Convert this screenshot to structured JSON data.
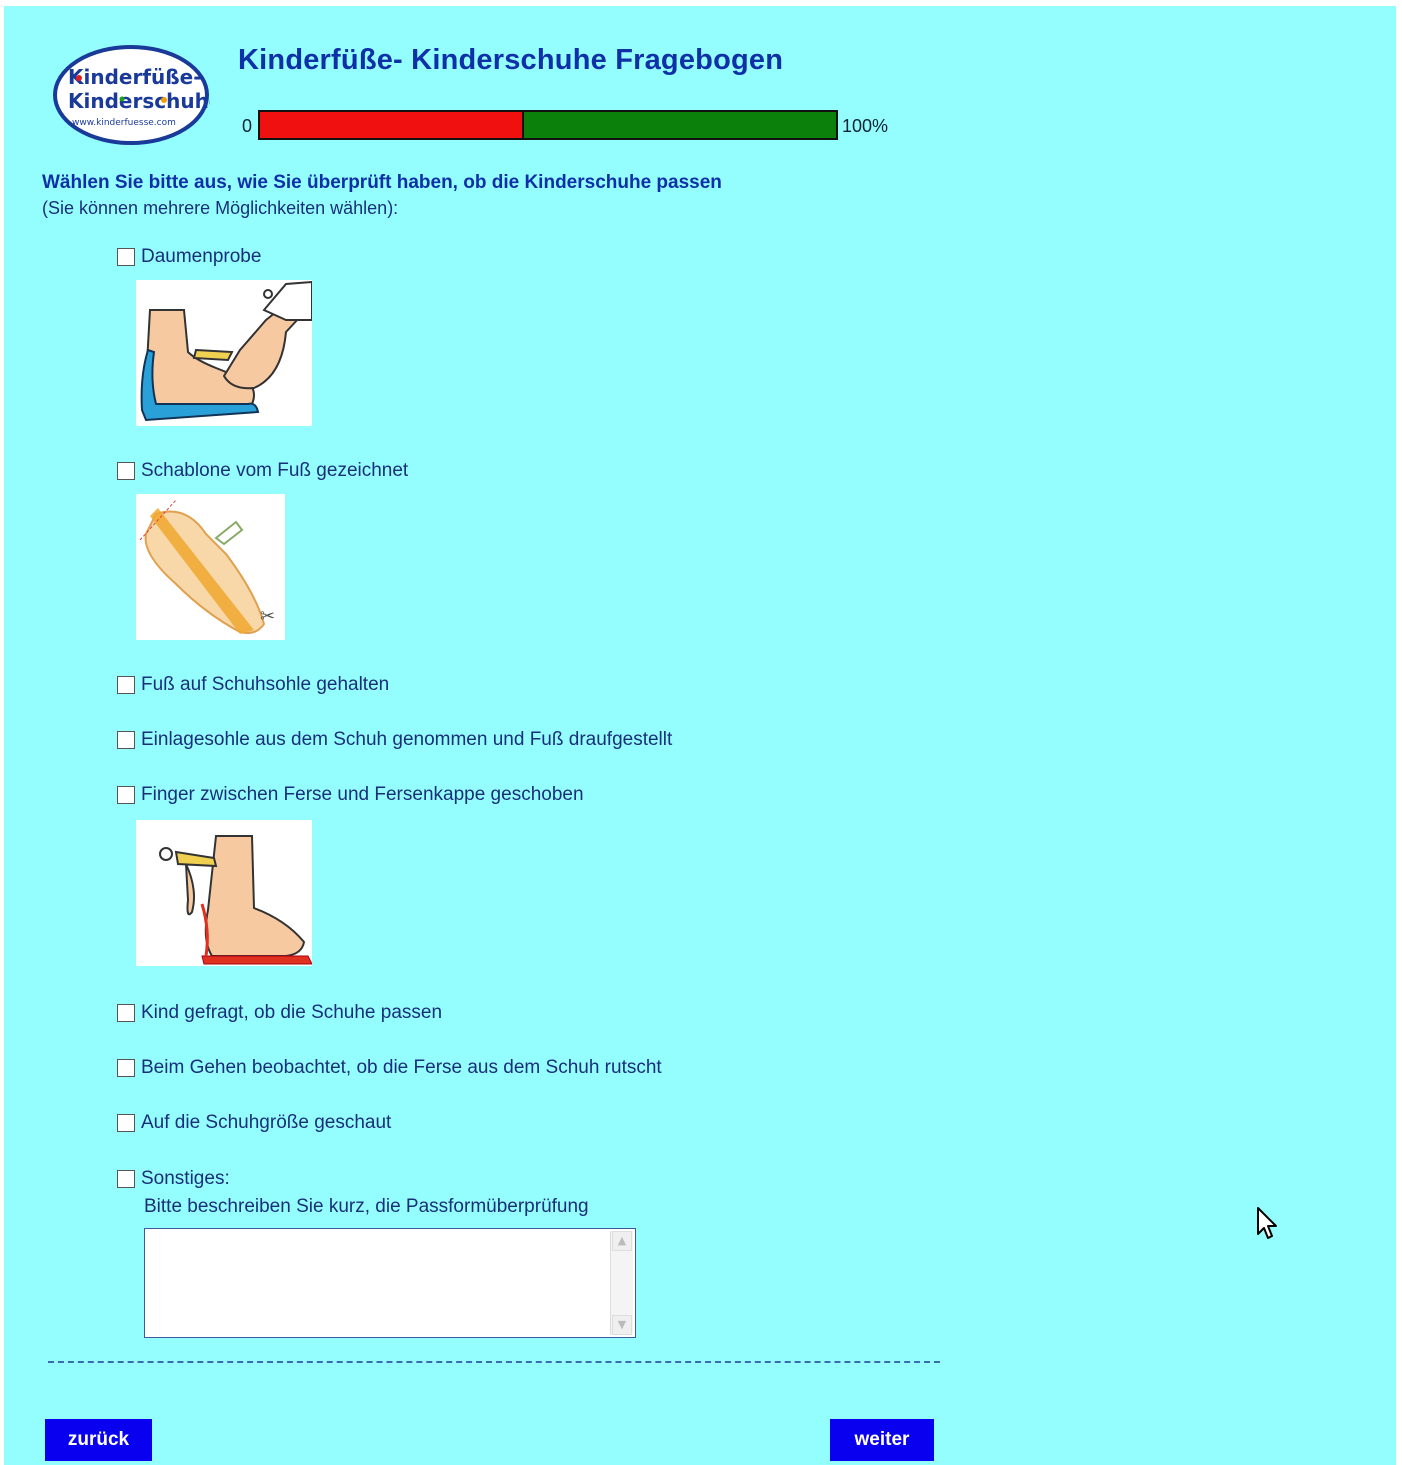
{
  "header": {
    "logo_line1": "Kinderfüße-",
    "logo_line2": "Kinderschuhe",
    "logo_url": "www.kinderfuesse.com",
    "title": "Kinderfüße- Kinderschuhe Fragebogen"
  },
  "progress": {
    "start_label": "0",
    "end_label": "100%",
    "fraction": 0.455,
    "done_color": "#f01010",
    "remaining_color": "#0b800b"
  },
  "question": {
    "text": "Wählen Sie bitte aus, wie Sie überprüft haben, ob die Kinderschuhe passen",
    "hint": "(Sie können mehrere Möglichkeiten wählen):"
  },
  "options": [
    {
      "label": "Daumenprobe",
      "checked": false
    },
    {
      "label": "Schablone vom Fuß gezeichnet",
      "checked": false
    },
    {
      "label": "Fuß auf Schuhsohle gehalten",
      "checked": false
    },
    {
      "label": "Einlagesohle aus dem Schuh genommen und Fuß draufgestellt",
      "checked": false
    },
    {
      "label": "Finger zwischen Ferse und Fersenkappe geschoben",
      "checked": false
    },
    {
      "label": "Kind gefragt, ob die Schuhe passen",
      "checked": false
    },
    {
      "label": "Beim Gehen beobachtet, ob die Ferse aus dem Schuh rutscht",
      "checked": false
    },
    {
      "label": "Auf die Schuhgröße geschaut",
      "checked": false
    },
    {
      "label": "Sonstiges:",
      "checked": false
    }
  ],
  "other": {
    "describe_label": "Bitte beschreiben Sie kurz, die Passformüberprüfung",
    "textarea_value": ""
  },
  "navigation": {
    "back_label": "zurück",
    "next_label": "weiter"
  },
  "colors": {
    "background": "#94fefe",
    "title": "#1030a8",
    "button": "#0a00f0"
  }
}
